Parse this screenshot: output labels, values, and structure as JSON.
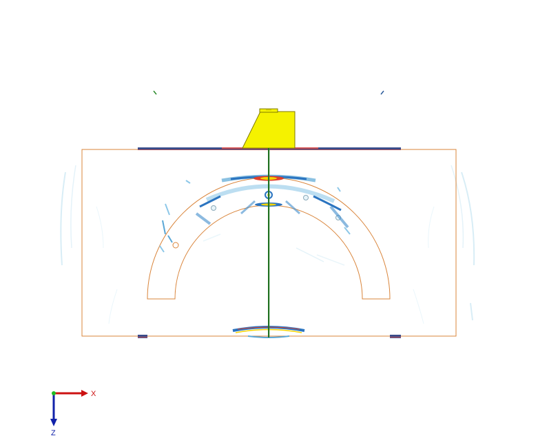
{
  "scene": {
    "background_color": "#ffffff",
    "part_outline_color": "#d9843a",
    "probe_color": "#f5f200",
    "probe_edge_color": "#7f7a00",
    "beam_color": "#1a6a1a",
    "scan_plate_color": "#3a4c8a"
  },
  "triad": {
    "x_label": "X",
    "z_label": "Z",
    "x_color": "#cc1111",
    "z_color": "#1122aa",
    "y_color": "#22bb22"
  }
}
